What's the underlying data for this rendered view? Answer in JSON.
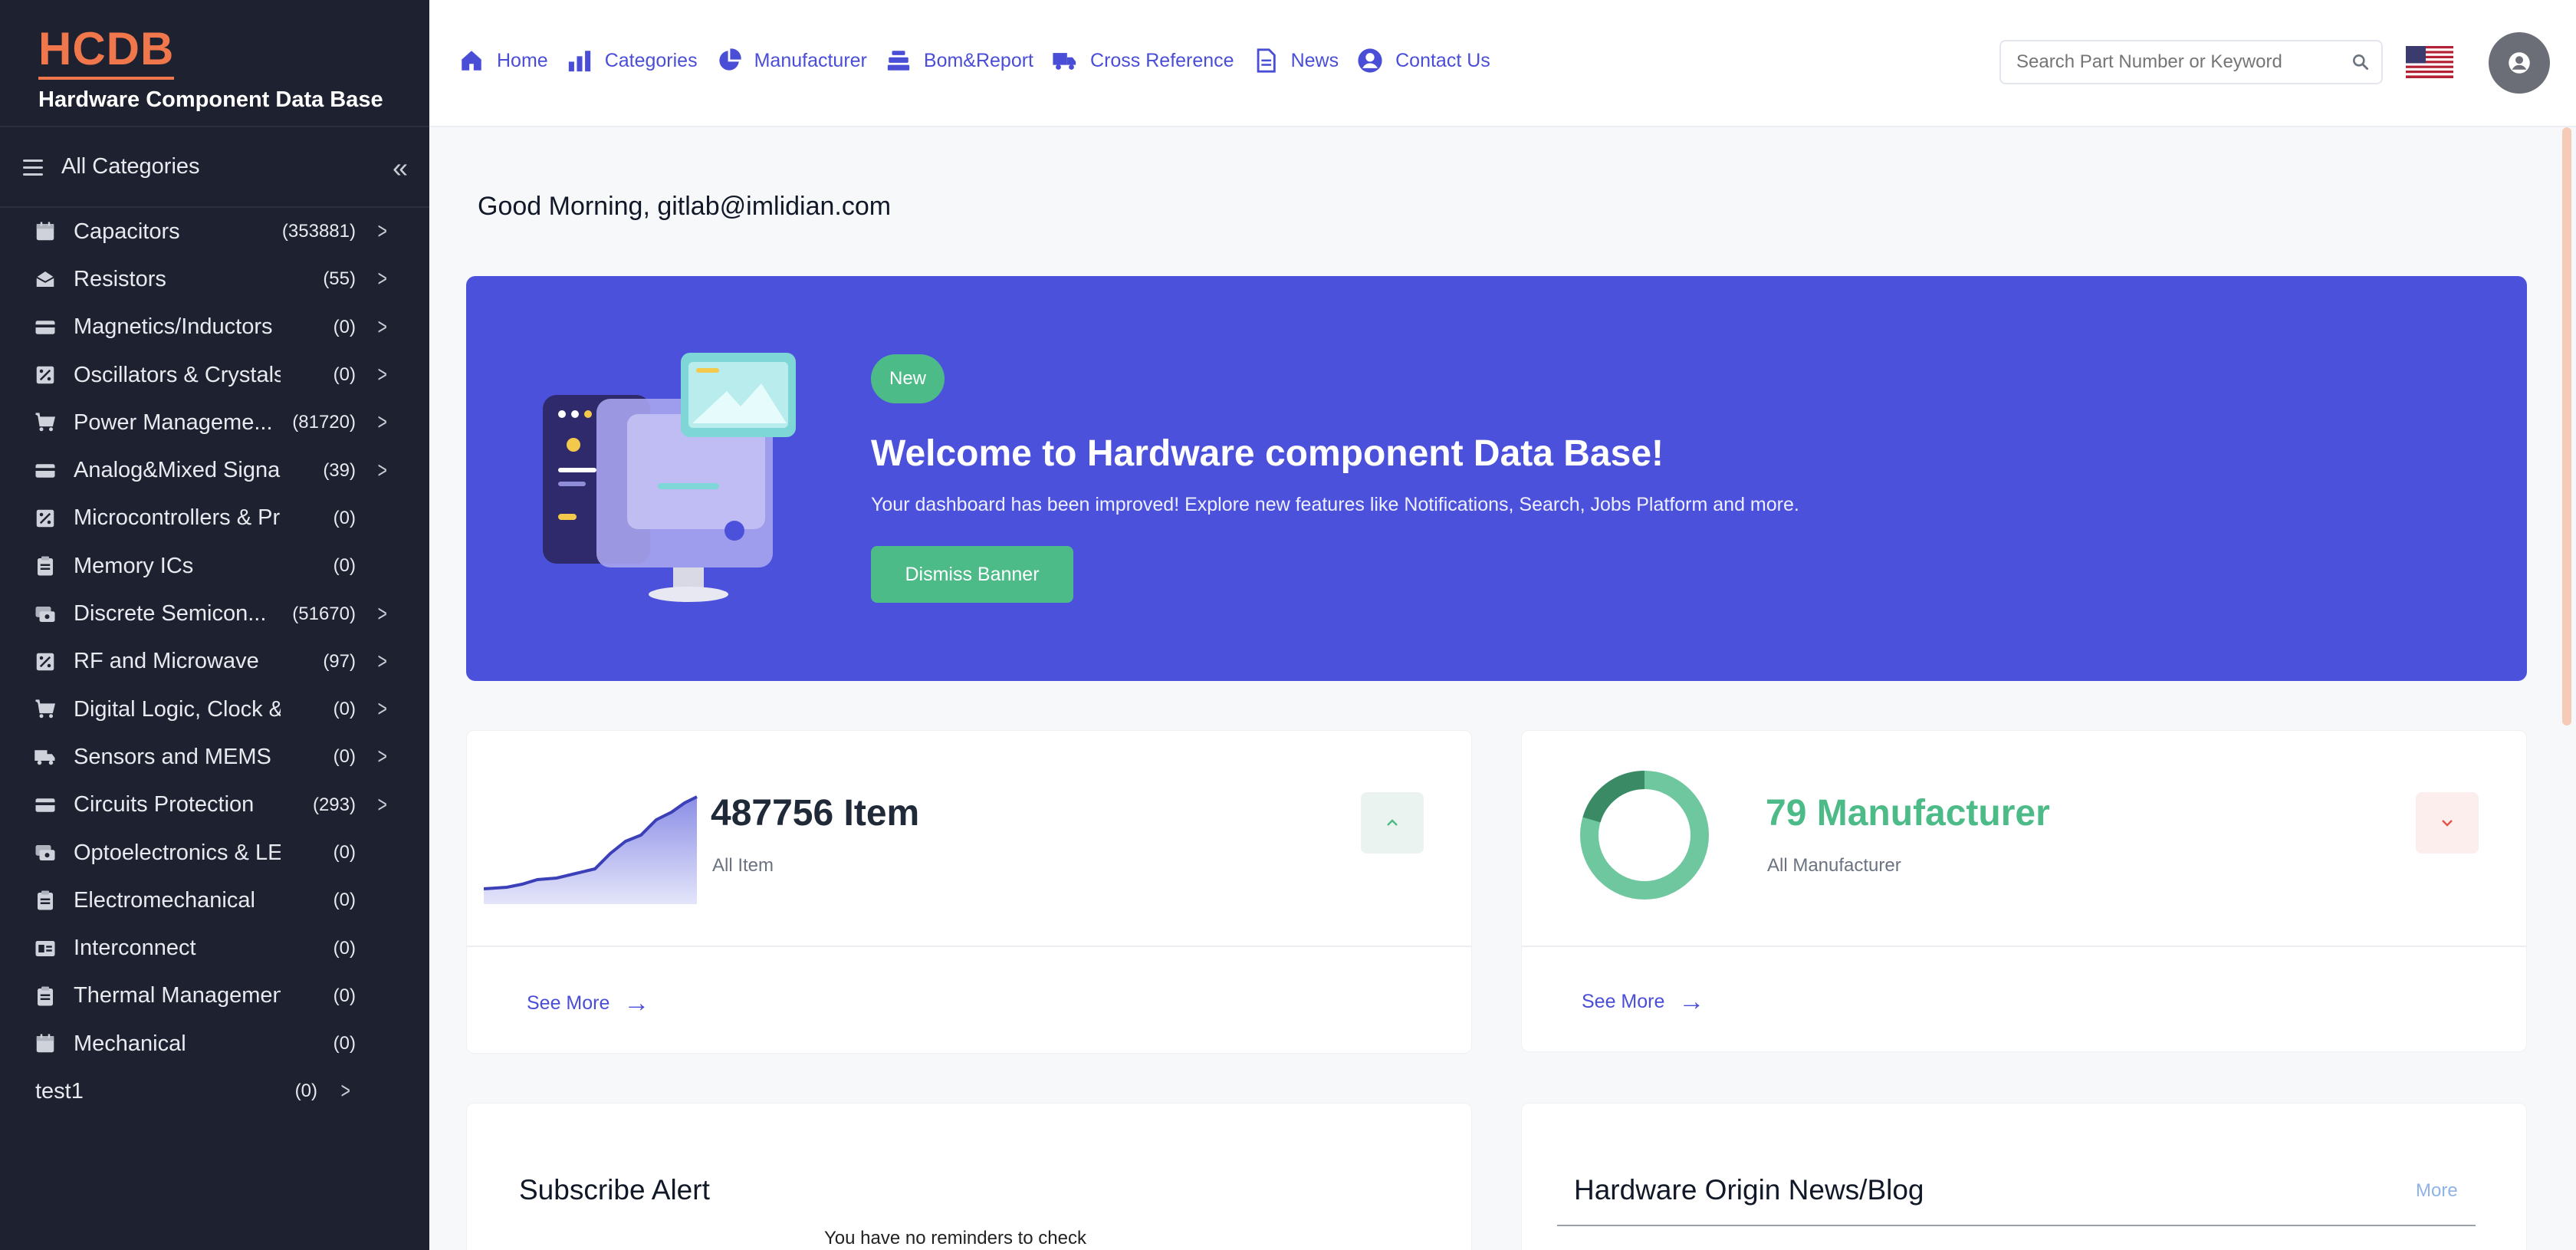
{
  "brand": {
    "logo": "HCDB",
    "subtitle": "Hardware Component Data Base",
    "logo_color": "#f0774b"
  },
  "sidebar": {
    "header": "All Categories",
    "categories": [
      {
        "label": "Capacitors",
        "count": "(353881)",
        "icon": "calendar-icon",
        "has_children": true
      },
      {
        "label": "Resistors",
        "count": "(55)",
        "icon": "envelope-open-icon",
        "has_children": true
      },
      {
        "label": "Magnetics/Inductors",
        "count": "(0)",
        "icon": "credit-card-icon",
        "has_children": true
      },
      {
        "label": "Oscillators & Crystals",
        "count": "(0)",
        "icon": "percent-square-icon",
        "has_children": true
      },
      {
        "label": "Power Manageme...",
        "count": "(81720)",
        "icon": "cart-icon",
        "has_children": true
      },
      {
        "label": "Analog&Mixed Signa...",
        "count": "(39)",
        "icon": "credit-card-icon",
        "has_children": true
      },
      {
        "label": "Microcontrollers & Pr...",
        "count": "(0)",
        "icon": "percent-square-icon",
        "has_children": false
      },
      {
        "label": "Memory ICs",
        "count": "(0)",
        "icon": "clipboard-icon",
        "has_children": false
      },
      {
        "label": "Discrete Semicon...",
        "count": "(51670)",
        "icon": "cards-icon",
        "has_children": true
      },
      {
        "label": "RF and Microwave",
        "count": "(97)",
        "icon": "percent-square-icon",
        "has_children": true
      },
      {
        "label": "Digital Logic, Clock & ...",
        "count": "(0)",
        "icon": "cart-icon",
        "has_children": true
      },
      {
        "label": "Sensors and MEMS",
        "count": "(0)",
        "icon": "truck-icon",
        "has_children": true
      },
      {
        "label": "Circuits Protection",
        "count": "(293)",
        "icon": "credit-card-icon",
        "has_children": true
      },
      {
        "label": "Optoelectronics & LEDs",
        "count": "(0)",
        "icon": "cards-icon",
        "has_children": false
      },
      {
        "label": "Electromechanical",
        "count": "(0)",
        "icon": "clipboard-icon",
        "has_children": false
      },
      {
        "label": "Interconnect",
        "count": "(0)",
        "icon": "id-card-icon",
        "has_children": false
      },
      {
        "label": "Thermal Management",
        "count": "(0)",
        "icon": "clipboard-icon",
        "has_children": false
      },
      {
        "label": "Mechanical",
        "count": "(0)",
        "icon": "calendar-icon",
        "has_children": false
      }
    ],
    "extra_item": {
      "label": "test1",
      "count": "(0)"
    }
  },
  "nav": {
    "items": [
      {
        "label": "Home",
        "icon": "home-icon"
      },
      {
        "label": "Categories",
        "icon": "bar-chart-icon"
      },
      {
        "label": "Manufacturer",
        "icon": "pie-chart-icon"
      },
      {
        "label": "Bom&Report",
        "icon": "layers-icon"
      },
      {
        "label": "Cross Reference",
        "icon": "truck-icon"
      },
      {
        "label": "News",
        "icon": "document-icon"
      },
      {
        "label": "Contact Us",
        "icon": "user-circle-icon"
      }
    ],
    "accent": "#4a4ed6"
  },
  "search": {
    "placeholder": "Search Part Number or Keyword"
  },
  "main": {
    "greeting": "Good Morning, gitlab@imlidian.com",
    "banner": {
      "badge": "New",
      "headline": "Welcome to Hardware component Data Base!",
      "description": "Your dashboard has been improved! Explore new features like Notifications, Search, Jobs Platform and more.",
      "dismiss_label": "Dismiss Banner",
      "background": "#4c51dc"
    },
    "items_card": {
      "value": "487756 Item",
      "label": "All Item",
      "see_more": "See More",
      "color": "#4a4ed6"
    },
    "manufacturer_card": {
      "value": "79 Manufacturer",
      "label": "All Manufacturer",
      "see_more": "See More",
      "color": "#4cbb88"
    },
    "subscribe": {
      "title": "Subscribe Alert",
      "message": "You have no reminders to check"
    },
    "news": {
      "title": "Hardware Origin News/Blog",
      "more": "More"
    }
  }
}
